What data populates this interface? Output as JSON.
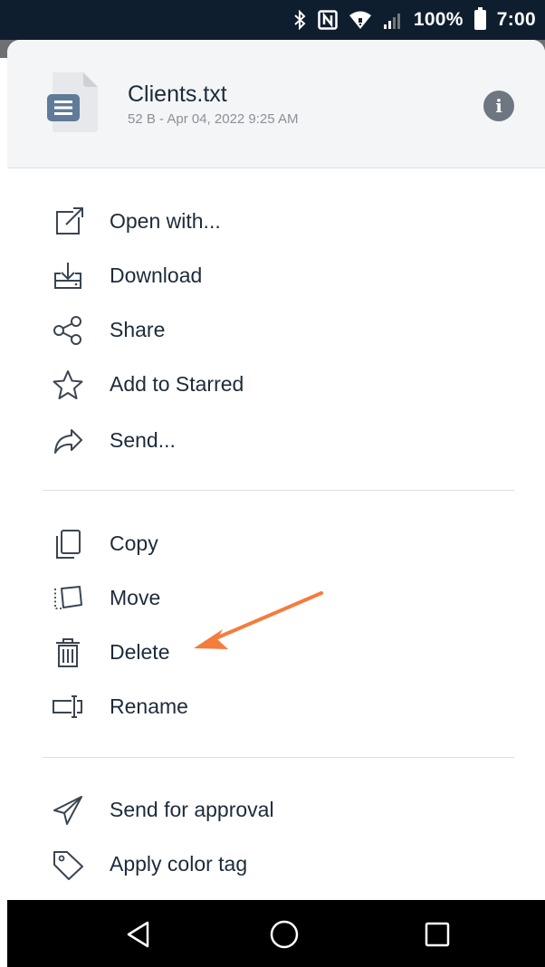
{
  "status_bar": {
    "battery_percent": "100%",
    "time": "7:00",
    "icons": [
      "bluetooth-icon",
      "nfc-icon",
      "wifi-icon",
      "signal-icon",
      "battery-icon"
    ]
  },
  "file": {
    "name": "Clients.txt",
    "meta": "52 B - Apr 04, 2022 9:25 AM",
    "icon": "text-file-icon",
    "info_glyph": "i"
  },
  "menu": {
    "group1": [
      {
        "label": "Open with...",
        "icon": "open-external-icon"
      },
      {
        "label": "Download",
        "icon": "download-icon"
      },
      {
        "label": "Share",
        "icon": "share-icon"
      },
      {
        "label": "Add to Starred",
        "icon": "star-icon"
      },
      {
        "label": "Send...",
        "icon": "send-arrow-icon"
      }
    ],
    "group2": [
      {
        "label": "Copy",
        "icon": "copy-icon"
      },
      {
        "label": "Move",
        "icon": "move-icon"
      },
      {
        "label": "Delete",
        "icon": "trash-icon"
      },
      {
        "label": "Rename",
        "icon": "rename-icon"
      }
    ],
    "group3": [
      {
        "label": "Send for approval",
        "icon": "paper-plane-icon"
      },
      {
        "label": "Apply color tag",
        "icon": "tag-icon"
      }
    ]
  },
  "navigation": {
    "icons": [
      "back-icon",
      "home-icon",
      "recents-icon"
    ]
  },
  "colors": {
    "status_bar_bg": "#0f1e2f",
    "header_bg": "#f4f5f6",
    "text_primary": "#1d2b3a",
    "text_secondary": "#8a9199",
    "annotation_arrow": "#f47c3c",
    "file_icon_accent": "#5f7b97"
  }
}
